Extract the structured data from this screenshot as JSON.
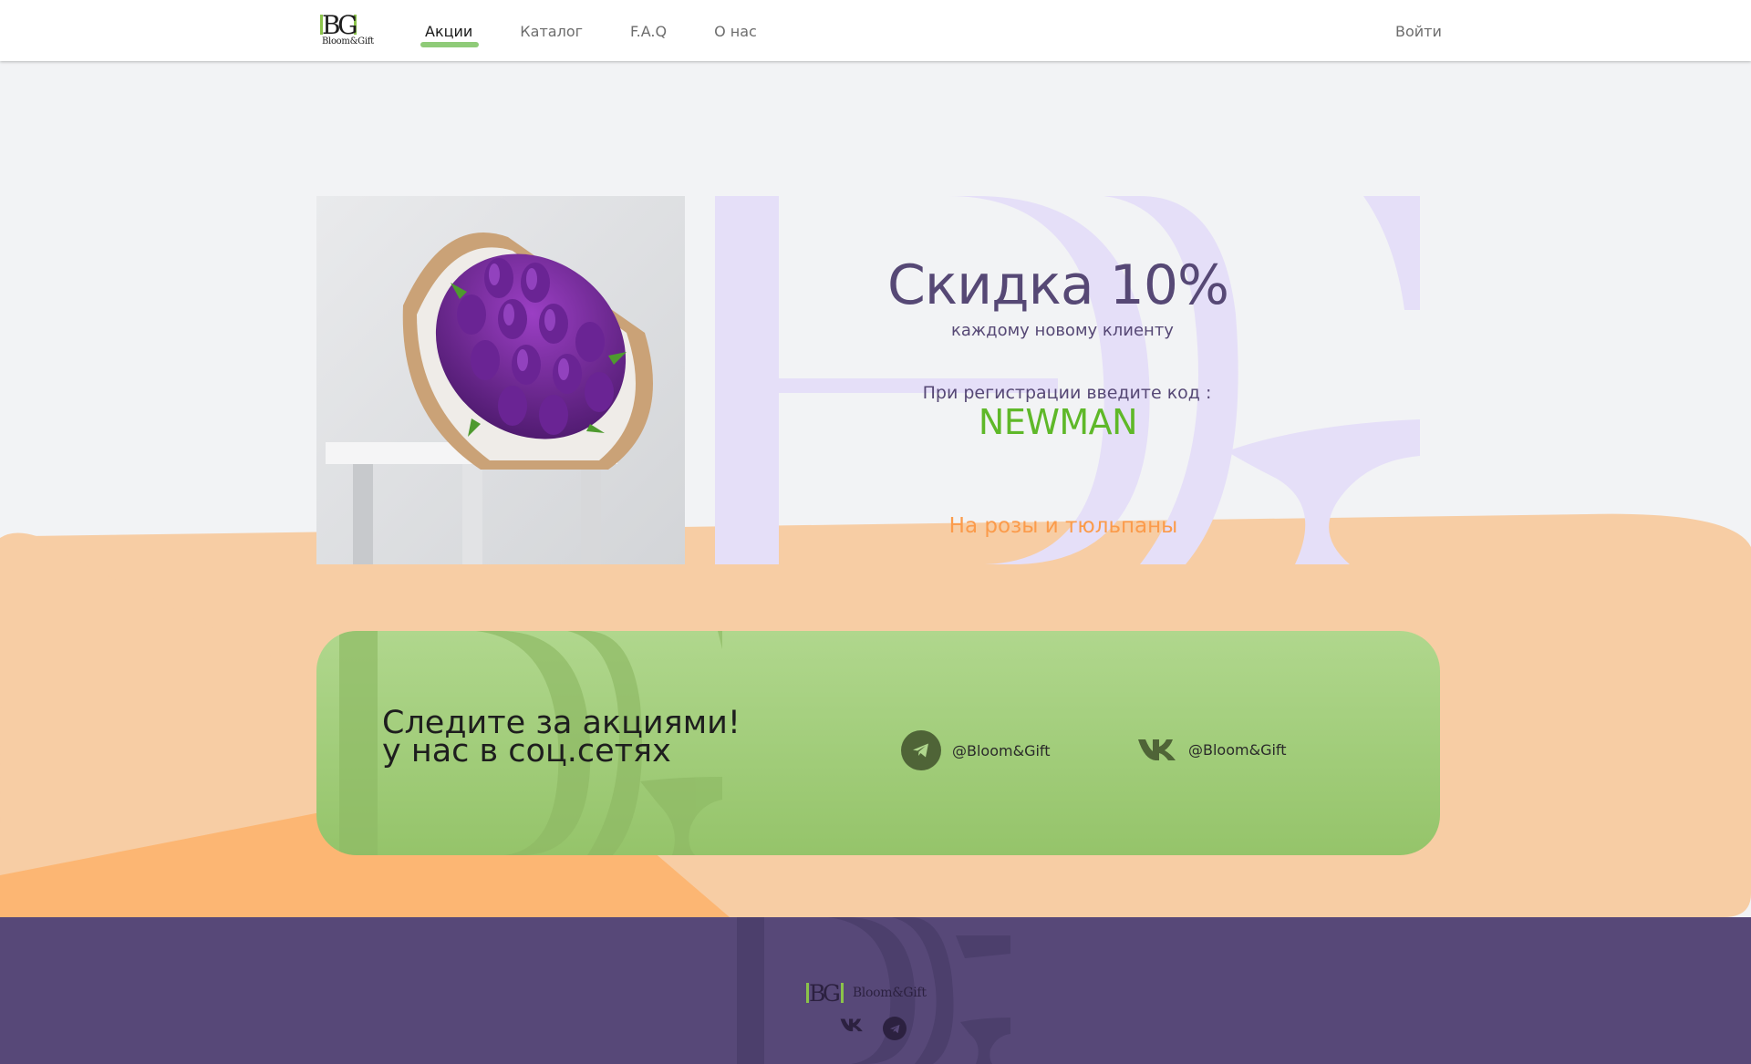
{
  "brand": {
    "mono": "BG",
    "name": "Bloom&Gift"
  },
  "nav": {
    "items": [
      {
        "label": "Акции",
        "active": true
      },
      {
        "label": "Каталог",
        "active": false
      },
      {
        "label": "F.A.Q",
        "active": false
      },
      {
        "label": "О нас",
        "active": false
      }
    ],
    "login": "Войти"
  },
  "promo": {
    "title": "Скидка 10%",
    "subtitle": "каждому новому клиенту",
    "code_label": "При регистрации введите код :",
    "code": "NEWMAN",
    "note": "На розы и тюльпаны"
  },
  "social": {
    "title_line1": "Следите за акциями!",
    "title_line2": "у нас в соц.сетях",
    "telegram": {
      "icon": "telegram-icon",
      "handle": "@Bloom&Gift"
    },
    "vk": {
      "icon": "vk-icon",
      "handle": "@Bloom&Gift"
    }
  },
  "footer": {
    "mono": "BG",
    "name": "Bloom&Gift"
  },
  "colors": {
    "accent_green": "#5fb829",
    "purple": "#564875",
    "orange": "#fb9b4b",
    "footer_bg": "#574878",
    "banner_green": "#a4d07f"
  }
}
